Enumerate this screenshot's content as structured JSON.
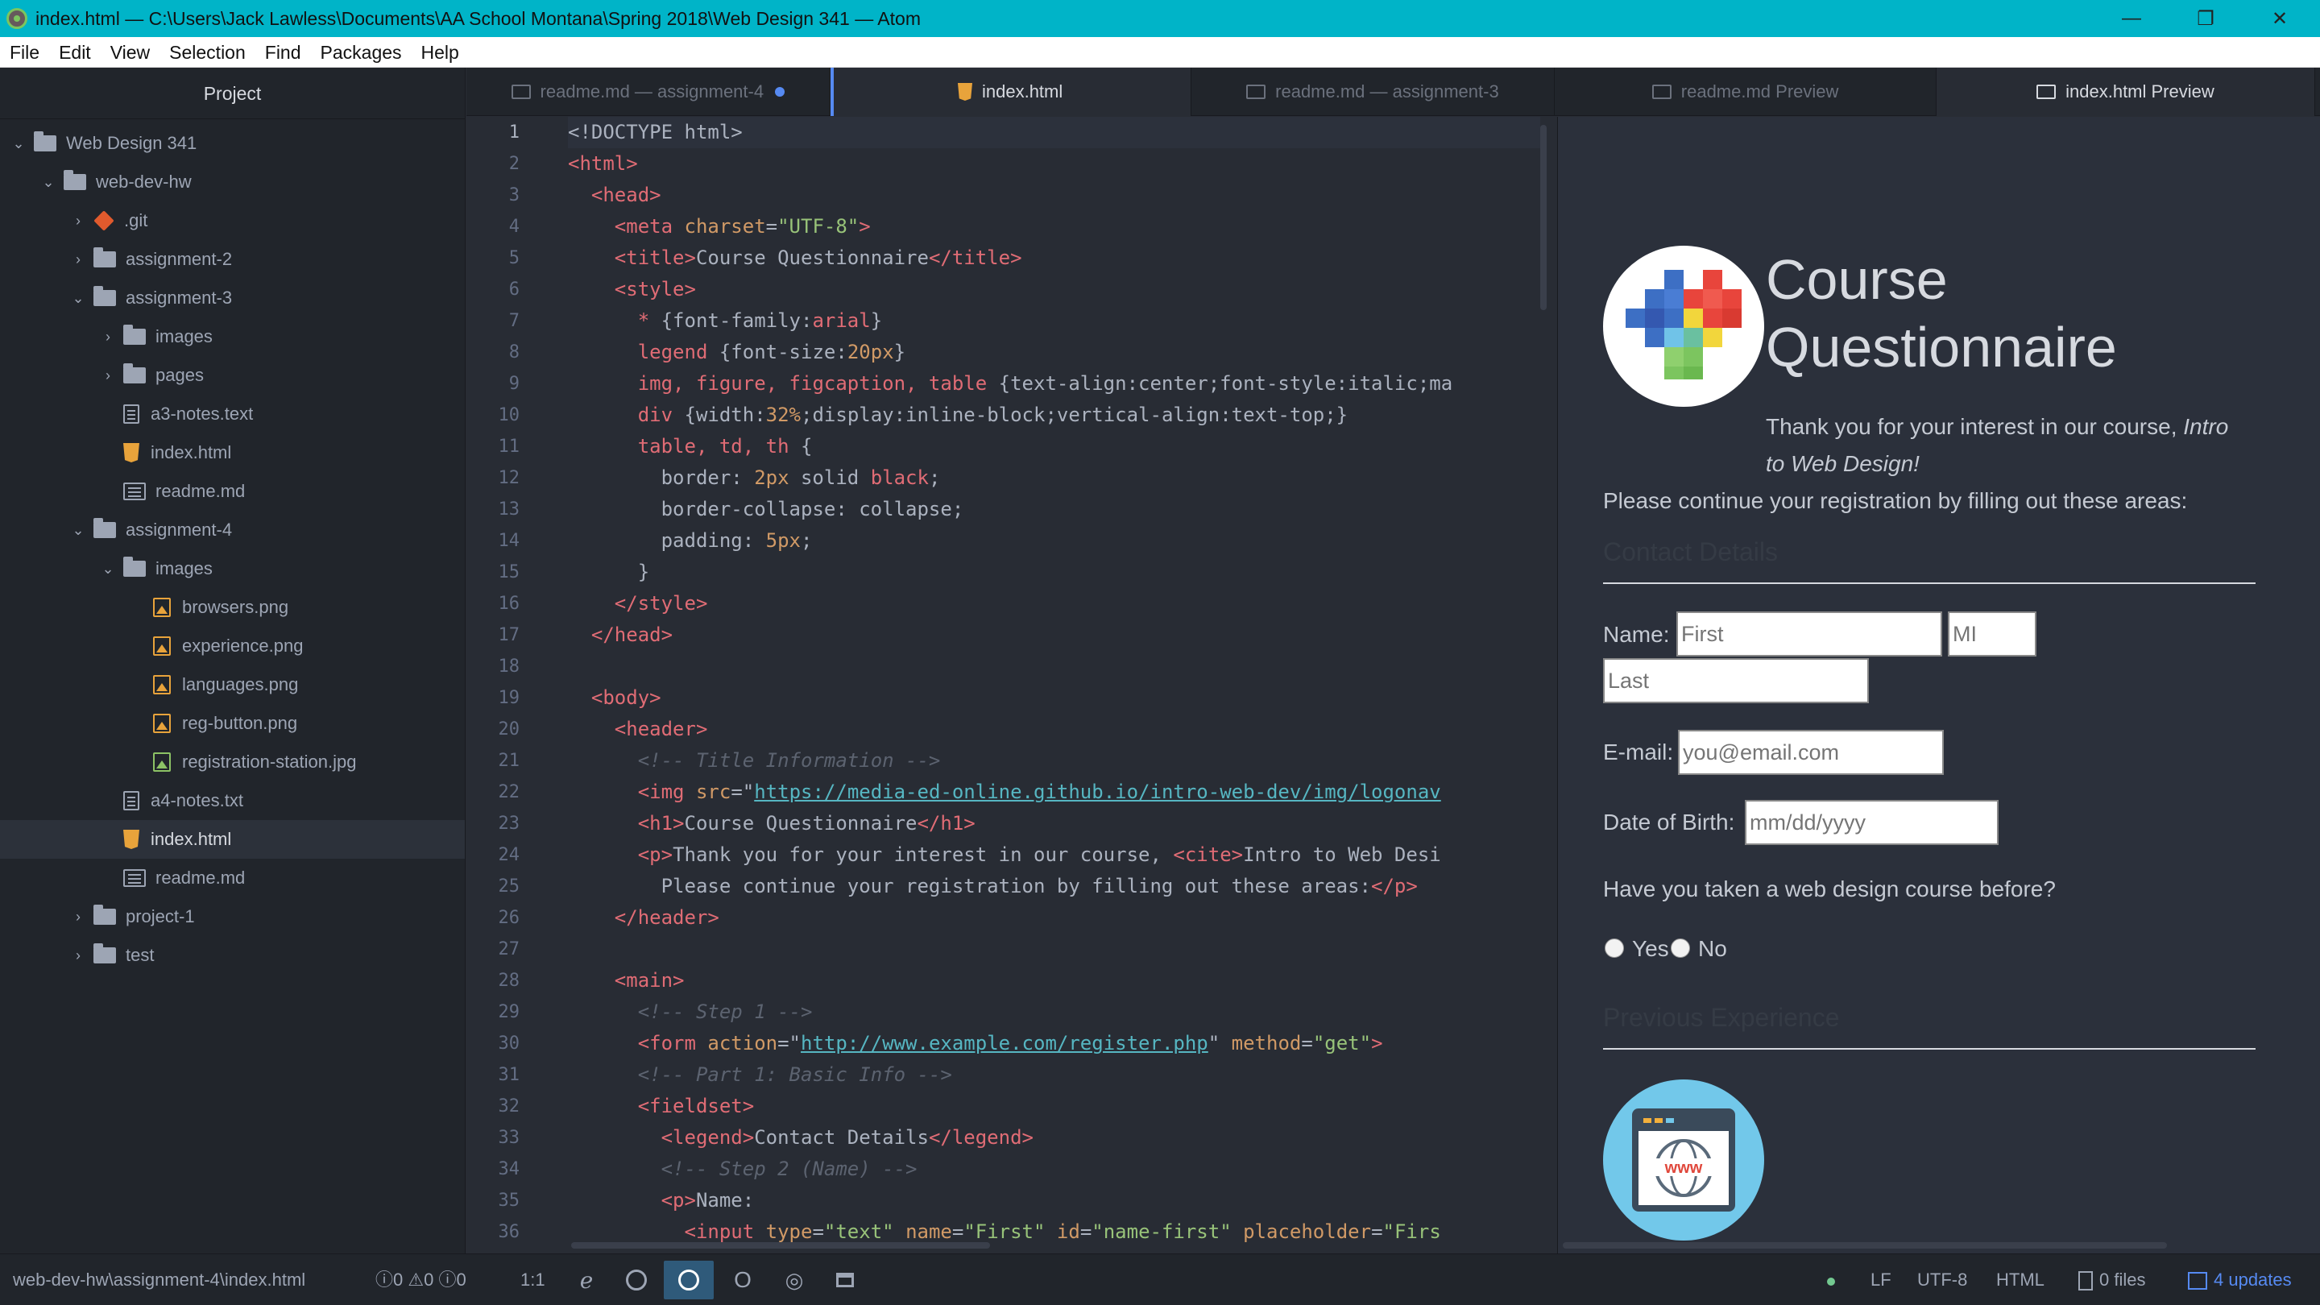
{
  "window": {
    "title": "index.html — C:\\Users\\Jack Lawless\\Documents\\AA School Montana\\Spring 2018\\Web Design 341 — Atom",
    "minimize": "—",
    "restore": "❐",
    "close": "✕"
  },
  "menu": [
    "File",
    "Edit",
    "View",
    "Selection",
    "Find",
    "Packages",
    "Help"
  ],
  "tree": {
    "header": "Project",
    "items": [
      {
        "label": "Web Design 341",
        "kind": "folder",
        "chev": "⌄",
        "depth": 0
      },
      {
        "label": "web-dev-hw",
        "kind": "folder",
        "chev": "⌄",
        "depth": 1
      },
      {
        "label": ".git",
        "kind": "git",
        "chev": "›",
        "depth": 2
      },
      {
        "label": "assignment-2",
        "kind": "folder",
        "chev": "›",
        "depth": 2
      },
      {
        "label": "assignment-3",
        "kind": "folder",
        "chev": "⌄",
        "depth": 2
      },
      {
        "label": "images",
        "kind": "folder",
        "chev": "›",
        "depth": 3
      },
      {
        "label": "pages",
        "kind": "folder",
        "chev": "›",
        "depth": 3
      },
      {
        "label": "a3-notes.text",
        "kind": "text",
        "chev": "",
        "depth": 3
      },
      {
        "label": "index.html",
        "kind": "html",
        "chev": "",
        "depth": 3
      },
      {
        "label": "readme.md",
        "kind": "md",
        "chev": "",
        "depth": 3
      },
      {
        "label": "assignment-4",
        "kind": "folder",
        "chev": "⌄",
        "depth": 2
      },
      {
        "label": "images",
        "kind": "folder",
        "chev": "⌄",
        "depth": 3
      },
      {
        "label": "browsers.png",
        "kind": "img",
        "chev": "",
        "depth": 4
      },
      {
        "label": "experience.png",
        "kind": "img",
        "chev": "",
        "depth": 4
      },
      {
        "label": "languages.png",
        "kind": "img",
        "chev": "",
        "depth": 4
      },
      {
        "label": "reg-button.png",
        "kind": "img",
        "chev": "",
        "depth": 4
      },
      {
        "label": "registration-station.jpg",
        "kind": "imggreen",
        "chev": "",
        "depth": 4
      },
      {
        "label": "a4-notes.txt",
        "kind": "text",
        "chev": "",
        "depth": 3
      },
      {
        "label": "index.html",
        "kind": "html",
        "chev": "",
        "depth": 3,
        "selected": true
      },
      {
        "label": "readme.md",
        "kind": "md",
        "chev": "",
        "depth": 3
      },
      {
        "label": "project-1",
        "kind": "folder",
        "chev": "›",
        "depth": 2
      },
      {
        "label": "test",
        "kind": "folder",
        "chev": "›",
        "depth": 2
      }
    ]
  },
  "tabs": [
    {
      "label": "readme.md — assignment-4",
      "icon": "md",
      "modified": true
    },
    {
      "label": "index.html",
      "icon": "html",
      "active": true
    },
    {
      "label": "readme.md — assignment-3",
      "icon": "md"
    },
    {
      "label": "readme.md Preview",
      "icon": "md"
    },
    {
      "label": "index.html Preview",
      "icon": "md",
      "active": true
    }
  ],
  "editor": {
    "current_line": 1,
    "lines": [
      [
        [
          "p",
          "<!DOCTYPE html>"
        ]
      ],
      [
        [
          "t",
          "<html>"
        ]
      ],
      [
        [
          "p",
          "  "
        ],
        [
          "t",
          "<head>"
        ]
      ],
      [
        [
          "p",
          "    "
        ],
        [
          "t",
          "<meta "
        ],
        [
          "a",
          "charset"
        ],
        [
          "p",
          "="
        ],
        [
          "s",
          "\"UTF-8\""
        ],
        [
          "t",
          ">"
        ]
      ],
      [
        [
          "p",
          "    "
        ],
        [
          "t",
          "<title>"
        ],
        [
          "p",
          "Course Questionnaire"
        ],
        [
          "t",
          "</title>"
        ]
      ],
      [
        [
          "p",
          "    "
        ],
        [
          "t",
          "<style>"
        ]
      ],
      [
        [
          "p",
          "      "
        ],
        [
          "t",
          "* "
        ],
        [
          "p",
          "{font-family:"
        ],
        [
          "t",
          "arial"
        ],
        [
          "p",
          "}"
        ]
      ],
      [
        [
          "p",
          "      "
        ],
        [
          "t",
          "legend "
        ],
        [
          "p",
          "{font-size:"
        ],
        [
          "a",
          "20px"
        ],
        [
          "p",
          "}"
        ]
      ],
      [
        [
          "p",
          "      "
        ],
        [
          "t",
          "img, figure, figcaption, table "
        ],
        [
          "p",
          "{text-align:center;font-style:italic;ma"
        ]
      ],
      [
        [
          "p",
          "      "
        ],
        [
          "t",
          "div "
        ],
        [
          "p",
          "{width:"
        ],
        [
          "a",
          "32%"
        ],
        [
          "p",
          ";display:inline-block;vertical-align:text-top;}"
        ]
      ],
      [
        [
          "p",
          "      "
        ],
        [
          "t",
          "table, td, th "
        ],
        [
          "p",
          "{"
        ]
      ],
      [
        [
          "p",
          "        border: "
        ],
        [
          "a",
          "2px "
        ],
        [
          "p",
          "solid "
        ],
        [
          "t",
          "black"
        ],
        [
          "p",
          ";"
        ]
      ],
      [
        [
          "p",
          "        border-collapse: collapse;"
        ]
      ],
      [
        [
          "p",
          "        padding: "
        ],
        [
          "a",
          "5px"
        ],
        [
          "p",
          ";"
        ]
      ],
      [
        [
          "p",
          "      }"
        ]
      ],
      [
        [
          "p",
          "    "
        ],
        [
          "t",
          "</style>"
        ]
      ],
      [
        [
          "p",
          "  "
        ],
        [
          "t",
          "</head>"
        ]
      ],
      [
        [
          "p",
          ""
        ]
      ],
      [
        [
          "p",
          "  "
        ],
        [
          "t",
          "<body>"
        ]
      ],
      [
        [
          "p",
          "    "
        ],
        [
          "t",
          "<header>"
        ]
      ],
      [
        [
          "p",
          "      "
        ],
        [
          "c",
          "<!-- Title Information -->"
        ]
      ],
      [
        [
          "p",
          "      "
        ],
        [
          "t",
          "<img "
        ],
        [
          "a",
          "src"
        ],
        [
          "p",
          "=\""
        ],
        [
          "u",
          "https://media-ed-online.github.io/intro-web-dev/img/logonav"
        ]
      ],
      [
        [
          "p",
          "      "
        ],
        [
          "t",
          "<h1>"
        ],
        [
          "p",
          "Course Questionnaire"
        ],
        [
          "t",
          "</h1>"
        ]
      ],
      [
        [
          "p",
          "      "
        ],
        [
          "t",
          "<p>"
        ],
        [
          "p",
          "Thank you for your interest in our course, "
        ],
        [
          "t",
          "<cite>"
        ],
        [
          "p",
          "Intro to Web Desi"
        ]
      ],
      [
        [
          "p",
          "        Please continue your registration by filling out these areas:"
        ],
        [
          "t",
          "</p>"
        ]
      ],
      [
        [
          "p",
          "    "
        ],
        [
          "t",
          "</header>"
        ]
      ],
      [
        [
          "p",
          ""
        ]
      ],
      [
        [
          "p",
          "    "
        ],
        [
          "t",
          "<main>"
        ]
      ],
      [
        [
          "p",
          "      "
        ],
        [
          "c",
          "<!-- Step 1 -->"
        ]
      ],
      [
        [
          "p",
          "      "
        ],
        [
          "t",
          "<form "
        ],
        [
          "a",
          "action"
        ],
        [
          "p",
          "=\""
        ],
        [
          "u",
          "http://www.example.com/register.php"
        ],
        [
          "p",
          "\" "
        ],
        [
          "a",
          "method"
        ],
        [
          "p",
          "="
        ],
        [
          "s",
          "\"get\""
        ],
        [
          "t",
          ">"
        ]
      ],
      [
        [
          "p",
          "      "
        ],
        [
          "c",
          "<!-- Part 1: Basic Info -->"
        ]
      ],
      [
        [
          "p",
          "      "
        ],
        [
          "t",
          "<fieldset>"
        ]
      ],
      [
        [
          "p",
          "        "
        ],
        [
          "t",
          "<legend>"
        ],
        [
          "p",
          "Contact Details"
        ],
        [
          "t",
          "</legend>"
        ]
      ],
      [
        [
          "p",
          "        "
        ],
        [
          "c",
          "<!-- Step 2 (Name) -->"
        ]
      ],
      [
        [
          "p",
          "        "
        ],
        [
          "t",
          "<p>"
        ],
        [
          "p",
          "Name:"
        ]
      ],
      [
        [
          "p",
          "          "
        ],
        [
          "t",
          "<input "
        ],
        [
          "a",
          "type"
        ],
        [
          "p",
          "="
        ],
        [
          "s",
          "\"text\" "
        ],
        [
          "a",
          "name"
        ],
        [
          "p",
          "="
        ],
        [
          "s",
          "\"First\" "
        ],
        [
          "a",
          "id"
        ],
        [
          "p",
          "="
        ],
        [
          "s",
          "\"name-first\" "
        ],
        [
          "a",
          "placeholder"
        ],
        [
          "p",
          "="
        ],
        [
          "s",
          "\"Firs"
        ]
      ]
    ]
  },
  "preview": {
    "title": "Course Questionnaire",
    "intro_1": "Thank you for your interest in our course, ",
    "intro_cite": "Intro to Web Design!",
    "intro_2": "Please continue your registration by filling out these areas:",
    "legend_contact": "Contact Details",
    "name_label": "Name:",
    "first_placeholder": "First",
    "mi_placeholder": "MI",
    "last_placeholder": "Last",
    "email_label": "E-mail:",
    "email_placeholder": "you@email.com",
    "dob_label": "Date of Birth:",
    "dob_placeholder": "mm/dd/yyyy",
    "question": "Have you taken a web design course before?",
    "yes": "Yes",
    "no": "No",
    "legend_experience": "Previous Experience",
    "www_text": "www"
  },
  "status": {
    "path": "web-dev-hw\\assignment-4\\index.html",
    "errors": "0",
    "warnings": "0",
    "infos": "0",
    "cursor": "1:1",
    "line_ending": "LF",
    "encoding": "UTF-8",
    "grammar": "HTML",
    "files": "0 files",
    "updates": "4 updates"
  },
  "colors": {
    "titlebar": "#00b4c8",
    "accent": "#568af2",
    "git_status": "#73c990"
  }
}
